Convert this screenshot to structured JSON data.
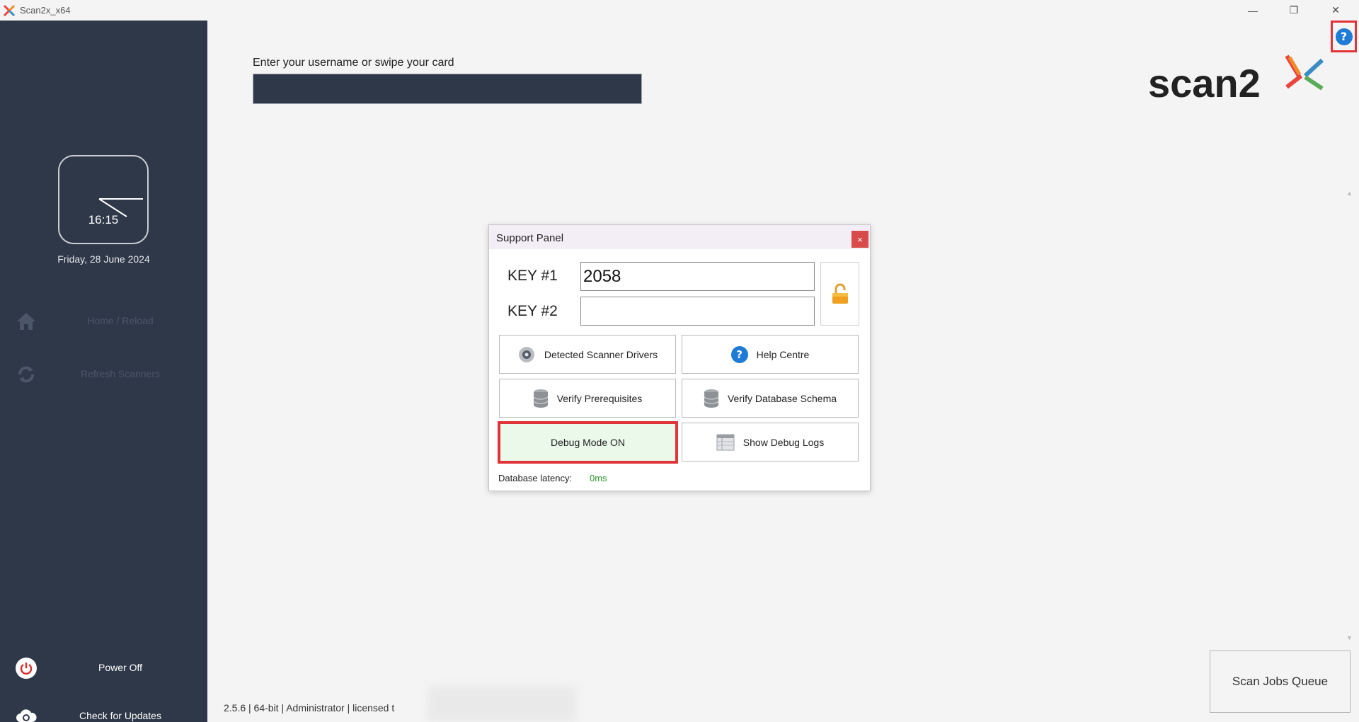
{
  "window": {
    "title": "Scan2x_x64",
    "minimize_icon": "minimize-icon",
    "maximize_icon": "restore-icon",
    "close_icon": "close-icon"
  },
  "help_button": {
    "icon": "help-icon",
    "glyph": "?"
  },
  "sidebar": {
    "clock_time": "16:15",
    "date": "Friday, 28 June 2024",
    "items": [
      {
        "label": "Home / Reload",
        "icon": "home-icon"
      },
      {
        "label": "Refresh Scanners",
        "icon": "refresh-icon"
      },
      {
        "label": "Power Off",
        "icon": "power-icon"
      },
      {
        "label": "Check for Updates",
        "icon": "cloud-update-icon"
      }
    ]
  },
  "login": {
    "label": "Enter your username or swipe your card",
    "value": ""
  },
  "logo": {
    "text": "scan2",
    "brand_colors": [
      "#222222",
      "#e8453c",
      "#f28c28",
      "#3a8dc4",
      "#5aab5a"
    ]
  },
  "support_panel": {
    "title": "Support Panel",
    "close_glyph": "×",
    "key1_label": "KEY #1",
    "key1_value": "2058",
    "key2_label": "KEY #2",
    "key2_value": "",
    "lock_icon": "unlock-icon",
    "buttons": {
      "drivers": "Detected Scanner Drivers",
      "help": "Help Centre",
      "prereq": "Verify Prerequisites",
      "schema": "Verify Database Schema",
      "debug": "Debug Mode ON",
      "logs": "Show Debug Logs"
    },
    "latency_label": "Database latency:",
    "latency_value": "0ms"
  },
  "queue_button": "Scan Jobs Queue",
  "footer": "2.5.6  |  64-bit  |  Administrator  |  licensed t",
  "colors": {
    "sidebar_bg": "#2f3849",
    "accent_blue": "#1f7bd6",
    "highlight_red": "#e0343a",
    "debug_bg": "#eaf9ea",
    "latency_green": "#2a9a2a"
  }
}
